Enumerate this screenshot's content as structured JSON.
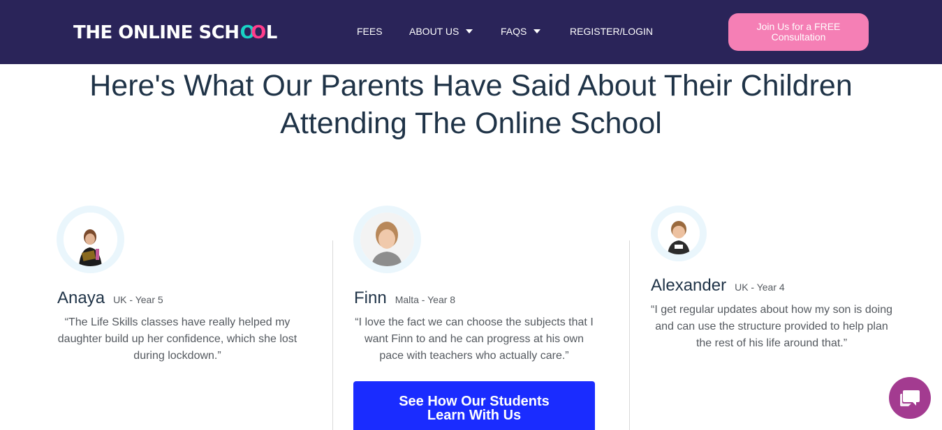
{
  "header": {
    "logo": {
      "text_main": "THE ONLINE SCH",
      "text_o1": "O",
      "text_o2": "O",
      "text_end": "L"
    },
    "nav": [
      {
        "label": "FEES",
        "has_dropdown": false
      },
      {
        "label": "ABOUT US",
        "has_dropdown": true
      },
      {
        "label": "FAQS",
        "has_dropdown": true
      },
      {
        "label": "REGISTER/LOGIN",
        "has_dropdown": false
      }
    ],
    "cta": {
      "line1": "Join Us for a FREE",
      "line2": "Consultation"
    }
  },
  "main": {
    "heading": {
      "line1": "Here's What Our Parents Have Said About Their Children",
      "line2": "Attending The Online School"
    },
    "testimonials": [
      {
        "name": "Anaya",
        "meta": "UK - Year 5",
        "quote": "“The Life Skills classes have really helped my daughter build up her confidence, which she lost during lockdown.”"
      },
      {
        "name": "Finn",
        "meta": "Malta - Year 8",
        "quote": "“I love the fact we can choose the subjects that I want  Finn to and he can progress at his own pace with teachers who actually care.”"
      },
      {
        "name": "Alexander",
        "meta": "UK - Year 4",
        "quote": "“I get regular updates about how my son is doing and can use the structure provided to help plan the rest of his life around that.”"
      }
    ],
    "cta_button": {
      "line1": "See How Our Students",
      "line2": "Learn With Us"
    }
  },
  "colors": {
    "header_bg": "#2a2459",
    "cta_pink": "#f57fb5",
    "heading_text": "#1f3347",
    "button_blue": "#1a2cff",
    "chat_purple": "#a33b90",
    "avatar_ring": "#eaf6fc"
  },
  "icons": {
    "dropdown": "caret-down-icon",
    "chat": "chat-bubble-icon"
  }
}
